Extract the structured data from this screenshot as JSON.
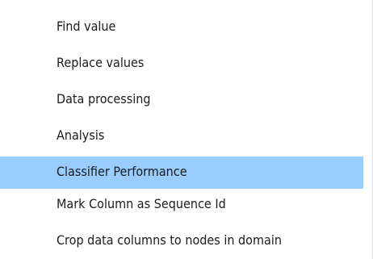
{
  "menu": {
    "items": [
      {
        "label": "Find value",
        "highlighted": false
      },
      {
        "label": "Replace values",
        "highlighted": false
      },
      {
        "label": "Data processing",
        "highlighted": false
      },
      {
        "label": "Analysis",
        "highlighted": false
      },
      {
        "label": "Classifier Performance",
        "highlighted": true
      },
      {
        "label": "Mark Column as Sequence Id",
        "highlighted": false
      },
      {
        "label": "Crop data columns to nodes in domain",
        "highlighted": false
      }
    ]
  },
  "colors": {
    "highlight": "#99ccff",
    "text": "#1b1b1b",
    "background": "#ffffff"
  }
}
